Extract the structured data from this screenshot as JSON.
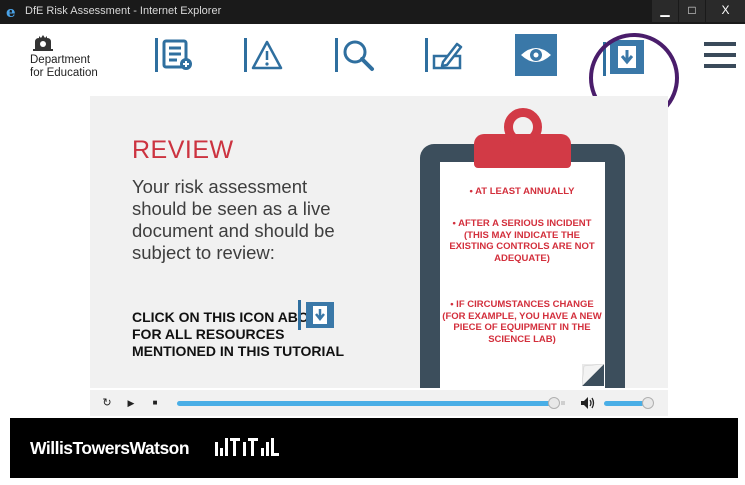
{
  "window": {
    "title": "DfE Risk Assessment - Internet Explorer",
    "ie_icon_glyph": "e",
    "minimize_glyph": "▁",
    "maximize_glyph": "□",
    "close_glyph": "X"
  },
  "toolbar": {
    "logo_line1": "Department",
    "logo_line2": "for Education",
    "icons": [
      "checklist-icon",
      "warning-icon",
      "search-icon",
      "sign-icon",
      "eye-icon",
      "download-icon",
      "menu-icon"
    ],
    "accent_color": "#3a78a8",
    "highlight_color": "#4a1d6b"
  },
  "slide": {
    "heading": "REVIEW",
    "body": "Your risk assessment should be seen as a live document and should be subject to review:",
    "cta": "CLICK ON THIS ICON ABOVE FOR ALL RESOURCES MENTIONED IN THIS TUTORIAL",
    "clipboard_items": [
      "• AT LEAST ANNUALLY",
      "• AFTER A SERIOUS INCIDENT (THIS MAY INDICATE THE EXISTING CONTROLS ARE NOT ADEQUATE)",
      "• IF CIRCUMSTANCES CHANGE (FOR EXAMPLE, YOU HAVE A NEW PIECE OF EQUIPMENT IN THE SCIENCE LAB)"
    ],
    "heading_color": "#cc3340",
    "clipboard_text_color": "#d32f3c"
  },
  "player": {
    "replay_glyph": "↻",
    "play_glyph": "▶",
    "stop_glyph": "■",
    "progress_fraction": 0.98,
    "volume_fraction": 0.9,
    "bar_color": "#49aee6"
  },
  "footer": {
    "brand": "WillisTowersWatson"
  }
}
